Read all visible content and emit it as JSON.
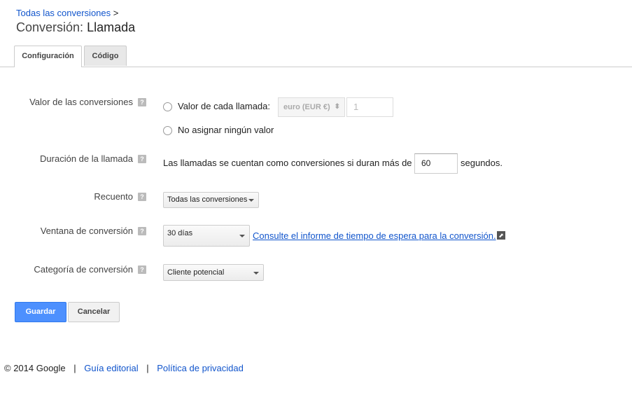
{
  "breadcrumb": {
    "link": "Todas las conversiones",
    "separator": ">"
  },
  "title": {
    "prefix": "Conversión:",
    "name": "Llamada"
  },
  "tabs": [
    {
      "label": "Configuración",
      "active": true
    },
    {
      "label": "Código",
      "active": false
    }
  ],
  "help_glyph": "?",
  "form": {
    "value": {
      "label": "Valor de las conversiones",
      "option1": "Valor de cada llamada:",
      "currency": "euro (EUR €)",
      "amount": "1",
      "option2": "No asignar ningún valor"
    },
    "duration": {
      "label": "Duración de la llamada",
      "text_before": "Las llamadas se cuentan como conversiones si duran más de",
      "seconds": "60",
      "text_after": "segundos."
    },
    "count": {
      "label": "Recuento",
      "selected": "Todas las conversiones"
    },
    "window": {
      "label": "Ventana de conversión",
      "selected": "30 días",
      "link": "Consulte el informe de tiempo de espera para la conversión."
    },
    "category": {
      "label": "Categoría de conversión",
      "selected": "Cliente potencial"
    }
  },
  "buttons": {
    "save": "Guardar",
    "cancel": "Cancelar"
  },
  "footer": {
    "copyright": "© 2014 Google",
    "separator": "|",
    "editorial": "Guía editorial",
    "privacy": "Política de privacidad"
  },
  "colors": {
    "link": "#1155cc",
    "primary_button": "#4d90fe"
  }
}
